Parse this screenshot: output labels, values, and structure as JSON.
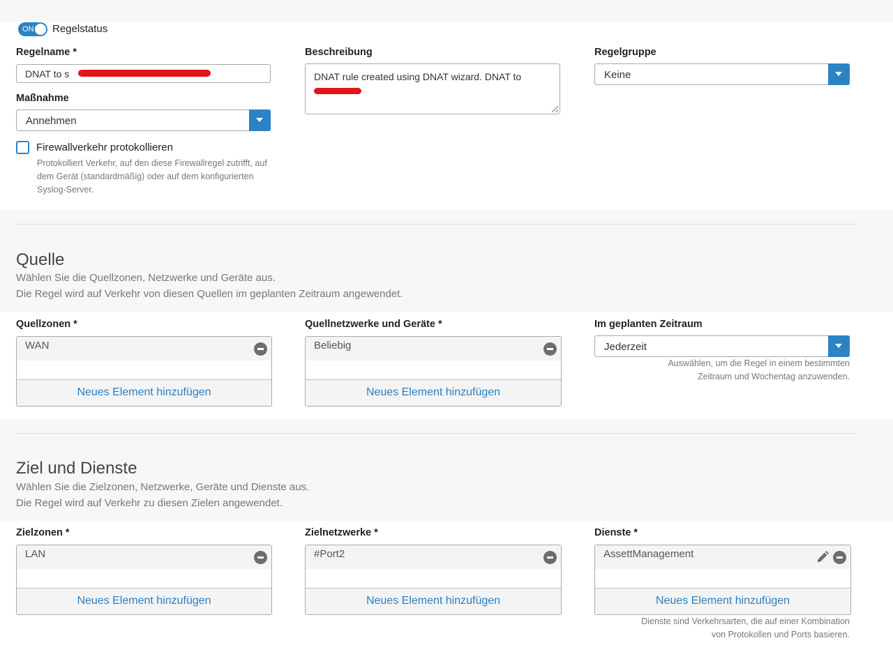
{
  "rule_status": {
    "toggle_label": "ON",
    "label": "Regelstatus"
  },
  "regelname": {
    "label": "Regelname *",
    "value": "DNAT to s"
  },
  "beschreibung": {
    "label": "Beschreibung",
    "value": "DNAT rule created using DNAT wizard. DNAT to"
  },
  "regelgruppe": {
    "label": "Regelgruppe",
    "value": "Keine"
  },
  "massnahme": {
    "label": "Maßnahme",
    "value": "Annehmen"
  },
  "log": {
    "label": "Firewallverkehr protokollieren",
    "help_lines": [
      "Protokolliert Verkehr, auf den diese Firewallregel zutrifft, auf",
      "dem Gerät (standardmäßig) oder auf dem konfigurierten",
      "Syslog-Server."
    ]
  },
  "quelle": {
    "title": "Quelle",
    "desc_lines": [
      "Wählen Sie die Quellzonen, Netzwerke und Geräte aus.",
      "Die Regel wird auf Verkehr von diesen Quellen im geplanten Zeitraum angewendet."
    ],
    "zonen": {
      "label": "Quellzonen *",
      "item": "WAN",
      "add": "Neues Element hinzufügen"
    },
    "netzwerke": {
      "label": "Quellnetzwerke und Geräte *",
      "item": "Beliebig",
      "add": "Neues Element hinzufügen"
    },
    "zeitraum": {
      "label": "Im geplanten Zeitraum",
      "value": "Jederzeit",
      "help_lines": [
        "Auswählen, um die Regel in einem bestimmten",
        "Zeitraum und Wochentag anzuwenden."
      ]
    }
  },
  "ziel": {
    "title": "Ziel und Dienste",
    "desc_lines": [
      "Wählen Sie die Zielzonen, Netzwerke, Geräte und Dienste aus.",
      "Die Regel wird auf Verkehr zu diesen Zielen angewendet."
    ],
    "zonen": {
      "label": "Zielzonen *",
      "item": "LAN",
      "add": "Neues Element hinzufügen"
    },
    "netzwerke": {
      "label": "Zielnetzwerke *",
      "item": "#Port2",
      "add": "Neues Element hinzufügen"
    },
    "dienste": {
      "label": "Dienste *",
      "item": "AssettManagement",
      "add": "Neues Element hinzufügen",
      "help_lines": [
        "Dienste sind Verkehrsarten, die auf einer Kombination",
        "von Protokollen und Ports basieren."
      ]
    }
  },
  "icons": {
    "minus": "minus-circle-icon",
    "edit": "pencil-icon",
    "dropdown": "chevron-down-icon"
  },
  "colors": {
    "accent": "#2b83c6",
    "link": "#2b7fbf",
    "redaction": "#e3141b",
    "section_bg": "#f7f7f7"
  }
}
